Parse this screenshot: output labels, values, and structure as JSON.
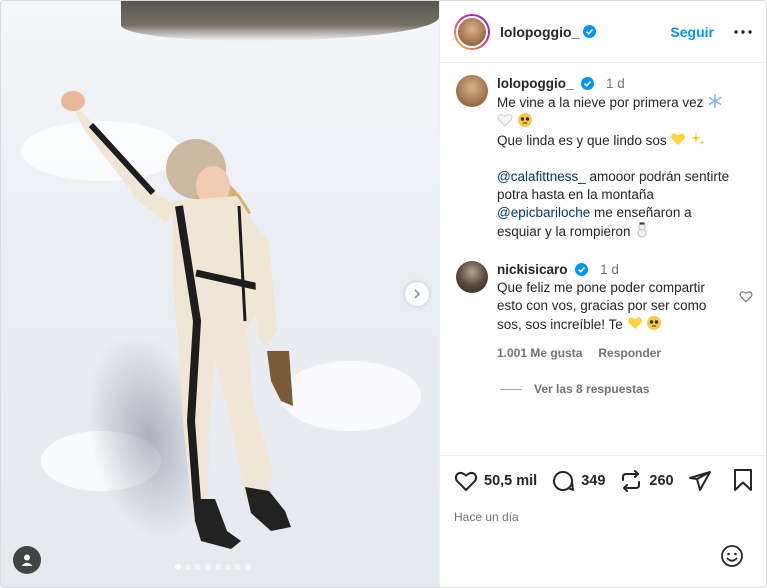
{
  "post": {
    "author": "lolopoggio_",
    "follow_label": "Seguir",
    "caption": {
      "time": "1 d",
      "line1": "Me vine a la nieve por primera vez",
      "line2": "Que linda es y que lindo sos",
      "mention1": "@calafittness_",
      "line3": " amooor podrán sentirte potra hasta en la montaña",
      "mention2": "@epicbariloche",
      "line4": " me enseñaron a esquiar y la rompieron"
    },
    "comment": {
      "author": "nickisicaro",
      "time": "1 d",
      "text": "Que feliz me pone poder compartir esto con vos, gracias por ser como sos, sos increíble! Te",
      "likes": "1.001 Me gusta",
      "reply_label": "Responder",
      "view_replies": "Ver las 8 respuestas"
    },
    "likes_count": "50,5 mil",
    "comments_count": "349",
    "reposts_count": "260",
    "date": "Hace un día"
  },
  "carousel": {
    "slide_count": 8,
    "active_index": 0
  },
  "colors": {
    "link_blue": "#0095f6",
    "mention_blue": "#00376b",
    "verified_blue": "#0095f6",
    "text_gray": "#737373"
  }
}
